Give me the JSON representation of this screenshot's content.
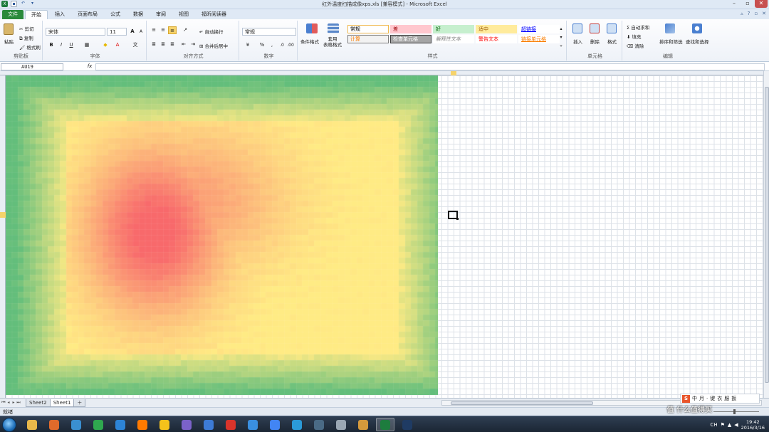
{
  "window": {
    "title": "红外温度扫描成像xps.xls  [兼容模式] - Microsoft Excel",
    "qat_icons": [
      "excel-icon",
      "save-icon",
      "undo-icon",
      "customize-qat-icon"
    ]
  },
  "tabs": [
    "文件",
    "开始",
    "插入",
    "页面布局",
    "公式",
    "数据",
    "审阅",
    "视图",
    "福昕阅读器"
  ],
  "active_tab": "开始",
  "ribbon": {
    "clipboard": {
      "paste": "粘贴",
      "cut": "剪切",
      "copy": "复制",
      "format_painter": "格式刷",
      "label": "剪贴板"
    },
    "font": {
      "name": "宋体",
      "size": "11",
      "label": "字体",
      "grow": "A",
      "shrink": "A",
      "bold": "B",
      "italic": "I",
      "underline": "U"
    },
    "alignment": {
      "wrap": "自动换行",
      "merge": "合并后居中",
      "label": "对齐方式"
    },
    "number": {
      "format": "常规",
      "percent": "%",
      "comma": ",",
      "label": "数字"
    },
    "styles": {
      "conditional": "条件格式",
      "table_format": "套用\n表格格式",
      "label": "样式",
      "cells": [
        {
          "text": "常规",
          "bg": "#ffffff",
          "fg": "#000000",
          "border": "#f0b74d"
        },
        {
          "text": "差",
          "bg": "#ffc7ce",
          "fg": "#9c0006",
          "border": "#ffc7ce"
        },
        {
          "text": "好",
          "bg": "#c6efce",
          "fg": "#006100",
          "border": "#c6efce"
        },
        {
          "text": "适中",
          "bg": "#ffeb9c",
          "fg": "#9c5700",
          "border": "#ffeb9c"
        },
        {
          "text": "超链接",
          "bg": "#ffffff",
          "fg": "#0000ff",
          "border": "#ffffff"
        },
        {
          "text": "计算",
          "bg": "#f2f2f2",
          "fg": "#fa7d00",
          "border": "#7f7f7f"
        },
        {
          "text": "检查单元格",
          "bg": "#a5a5a5",
          "fg": "#ffffff",
          "border": "#3f3f3f"
        },
        {
          "text": "解释性文本",
          "bg": "#ffffff",
          "fg": "#7f7f7f",
          "border": "#ffffff"
        },
        {
          "text": "警告文本",
          "bg": "#ffffff",
          "fg": "#ff0000",
          "border": "#ffffff"
        },
        {
          "text": "链接单元格",
          "bg": "#ffffff",
          "fg": "#fa7d00",
          "border": "#ffffff"
        }
      ]
    },
    "cells": {
      "insert": "插入",
      "delete": "删除",
      "format": "格式",
      "label": "单元格"
    },
    "editing": {
      "autosum": "自动求和",
      "fill": "填充",
      "clear": "清除",
      "sort": "排序和筛选",
      "find": "查找和选择",
      "label": "编辑"
    }
  },
  "formula_bar": {
    "name_box": "AU19",
    "fx": "fx",
    "value": ""
  },
  "sheet_tabs": [
    "Sheet2",
    "Sheet1"
  ],
  "active_sheet": "Sheet1",
  "status": {
    "text": "就绪"
  },
  "colors": {
    "hot": "#f8696b",
    "mid": "#ffeb84",
    "cool": "#63be7b"
  },
  "ime": {
    "items": [
      "中",
      "月",
      "·",
      "键",
      "衣",
      "服",
      "扳"
    ]
  },
  "taskbar": {
    "apps": [
      {
        "name": "explorer",
        "color": "#e8b84a"
      },
      {
        "name": "media",
        "color": "#e06a2b"
      },
      {
        "name": "bird",
        "color": "#3a8fd0"
      },
      {
        "name": "360",
        "color": "#2fa84f"
      },
      {
        "name": "ie",
        "color": "#2d84d6"
      },
      {
        "name": "taobao",
        "color": "#ff7a00"
      },
      {
        "name": "browser",
        "color": "#f5c21b"
      },
      {
        "name": "chrome-ball",
        "color": "#7b62c9"
      },
      {
        "name": "doc",
        "color": "#3d7bd6"
      },
      {
        "name": "tt",
        "color": "#d9342b"
      },
      {
        "name": "pen",
        "color": "#3a8fe0"
      },
      {
        "name": "chrome",
        "color": "#4285f4"
      },
      {
        "name": "network",
        "color": "#2b9ad8"
      },
      {
        "name": "screen",
        "color": "#4a6a85"
      },
      {
        "name": "player",
        "color": "#9aa7b4"
      },
      {
        "name": "game",
        "color": "#d59a3c"
      },
      {
        "name": "excel",
        "color": "#1d7c3e"
      },
      {
        "name": "photoshop",
        "color": "#1f3b63"
      }
    ],
    "clock_time": "19:42",
    "clock_date": "2016/3/16",
    "tray_lang": "CH",
    "watermark": "值 什么值得买"
  }
}
